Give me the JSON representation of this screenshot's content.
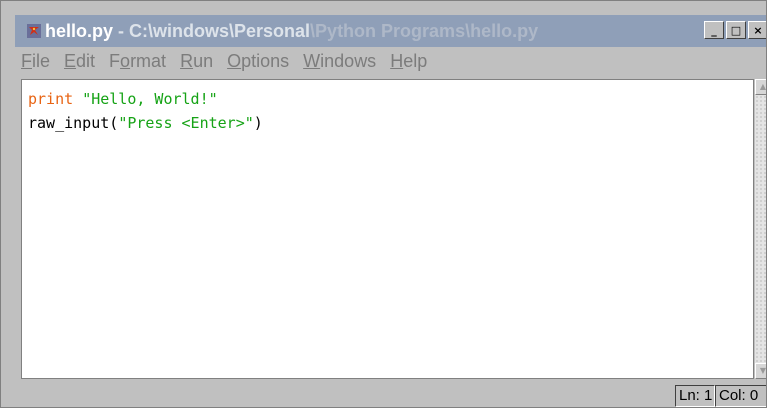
{
  "window": {
    "title_file": "hello.py",
    "title_sep": " - ",
    "title_path_start": "C:\\windows\\Personal",
    "title_path_end": "\\Python Programs\\hello.py",
    "icon": "python-snake-icon",
    "controls": {
      "minimize": "_",
      "maximize": "□",
      "close": "×"
    }
  },
  "menu": {
    "file": {
      "accel": "F",
      "rest": "ile"
    },
    "edit": {
      "accel": "E",
      "rest": "dit"
    },
    "format": {
      "pre": "F",
      "accel": "o",
      "rest": "rmat"
    },
    "run": {
      "accel": "R",
      "rest": "un"
    },
    "options": {
      "accel": "O",
      "rest": "ptions"
    },
    "windows": {
      "accel": "W",
      "rest": "indows"
    },
    "help": {
      "accel": "H",
      "rest": "elp"
    }
  },
  "editor": {
    "line1_keyword": "print",
    "line1_string": "\"Hello, World!\"",
    "line2_func": "raw_input(",
    "line2_string": "\"Press <Enter>\"",
    "line2_close": ")"
  },
  "status": {
    "line": "Ln: 1",
    "column": "Col: 0"
  },
  "colors": {
    "keyword": "#e86414",
    "string": "#16a316",
    "titlebar": "#8f9fb8"
  }
}
